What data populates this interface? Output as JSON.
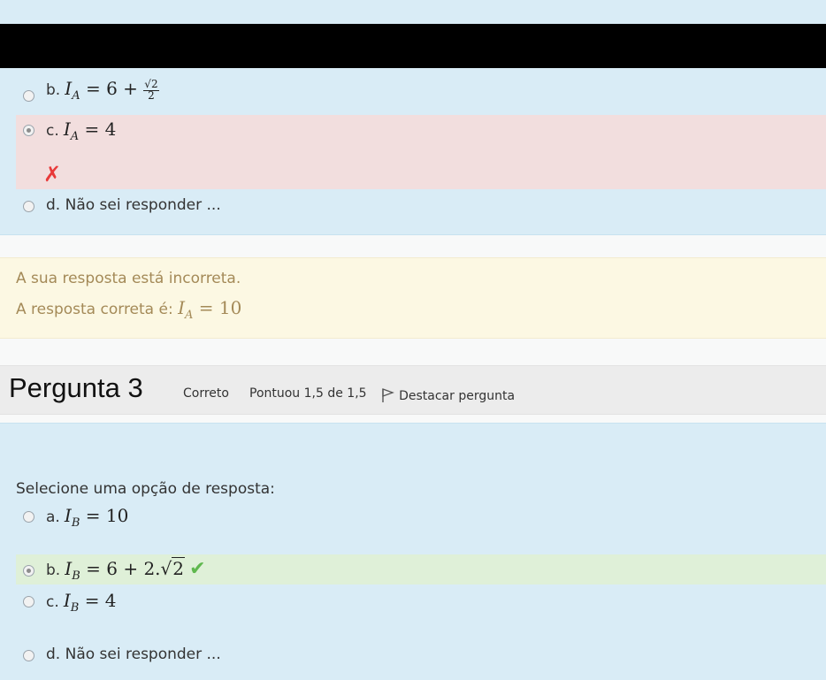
{
  "q2": {
    "option_b": {
      "label": "b.",
      "var": "I",
      "sub": "A",
      "rhs": "= 6 +",
      "frac_num": "2",
      "frac_den": "2"
    },
    "option_c": {
      "label": "c.",
      "var": "I",
      "sub": "A",
      "rhs": "= 4"
    },
    "option_d": {
      "label": "d.",
      "text": "Não sei responder ..."
    },
    "wrong_mark": "✗"
  },
  "feedback": {
    "line1": "A sua resposta está incorreta.",
    "line2": "A resposta correta é:",
    "answer_var": "I",
    "answer_sub": "A",
    "answer_rhs": "= 10"
  },
  "q3": {
    "title_word": "Pergunta",
    "number": "3",
    "status": "Correto",
    "score": "Pontuou 1,5 de 1,5",
    "flag_label": "Destacar pergunta",
    "prompt": "Selecione uma opção de resposta:",
    "option_a": {
      "label": "a.",
      "var": "I",
      "sub": "B",
      "rhs": "= 10"
    },
    "option_b": {
      "label": "b.",
      "var": "I",
      "sub": "B",
      "rhs": "= 6 + 2.",
      "radicand": "2"
    },
    "option_c": {
      "label": "c.",
      "var": "I",
      "sub": "B",
      "rhs": "= 4"
    },
    "option_d": {
      "label": "d.",
      "text": "Não sei responder ..."
    },
    "correct_mark": "✔"
  },
  "colors": {
    "panel_bg": "#d9ecf6",
    "wrong_bg": "#f2dede",
    "correct_bg": "#dff0d8",
    "feedback_bg": "#fcf8e3",
    "wrong_icon": "#e83a3a",
    "correct_icon": "#5fb84e"
  }
}
